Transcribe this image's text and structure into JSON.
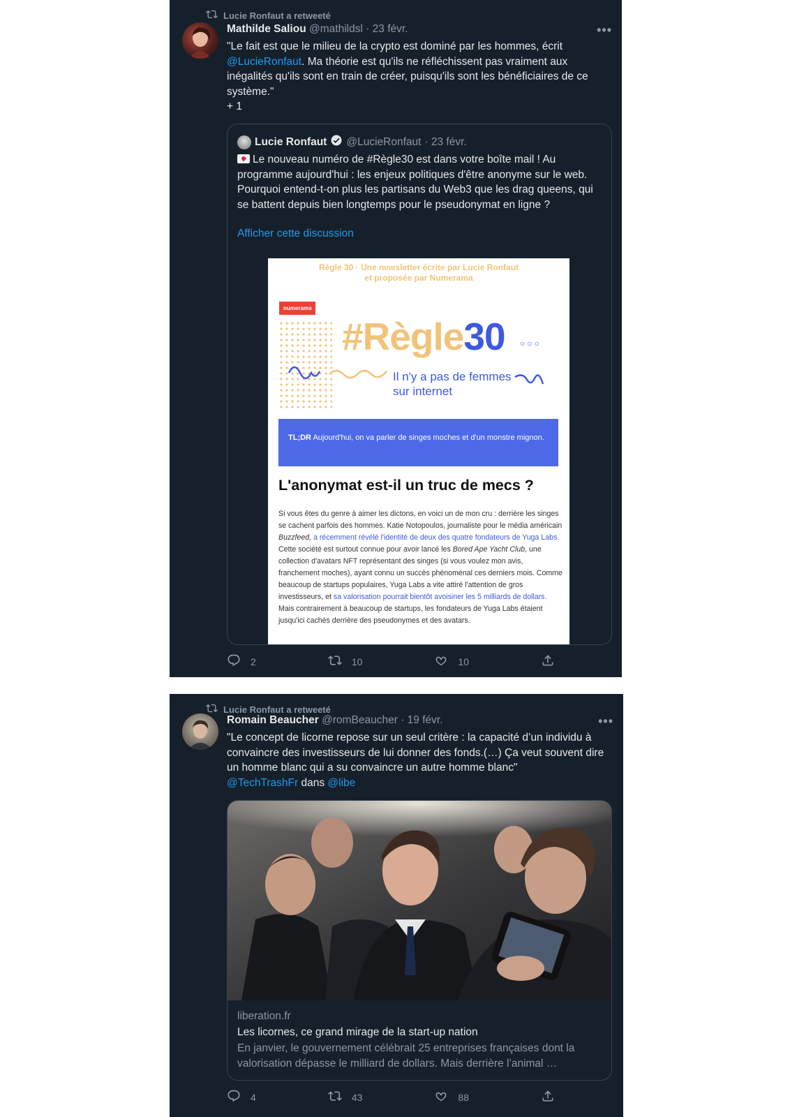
{
  "tweet1": {
    "retweet_label": "Lucie Ronfaut a retweeté",
    "author": "Mathilde Saliou",
    "handle": "@mathildsl",
    "date": "· 23 févr.",
    "more": "•••",
    "text_1": "\"Le fait est que le milieu de la crypto est dominé par les hommes, écrit ",
    "mention": "@LucieRonfaut",
    "text_2": ". Ma théorie est qu'ils ne réfléchissent pas vraiment aux inégalités qu'ils sont en train de créer, puisqu'ils sont les bénéficiaires de ce système.\"",
    "text_3": "+ 1",
    "quote": {
      "author": "Lucie Ronfaut",
      "handle": "@LucieRonfaut",
      "date": "· 23 févr.",
      "text": "Le nouveau numéro de #Règle30 est dans votre boîte mail ! Au programme aujourd'hui : les enjeux politiques d'être anonyme sur le web. Pourquoi entend-t-on plus les partisans du Web3 que les drag queens, qui se battent depuis bien longtemps pour le pseudonymat en ligne ?",
      "show_thread": "Afficher cette discussion"
    },
    "newsletter": {
      "top_line_1": "Règle 30 · Une newsletter écrite par Lucie Ronfaut",
      "top_line_2": "et proposée par Numerama",
      "tag": "numerama",
      "title_hash": "#Règle",
      "title_num": "30",
      "subtitle_1": "Il n'y a pas de femmes",
      "subtitle_2": "sur internet",
      "tldr_label": "TL;DR",
      "tldr_text": "Aujourd'hui, on va parler de singes moches et d'un monstre mignon.",
      "headline": "L'anonymat est-il un truc de mecs ?",
      "p1": "Si vous êtes du genre à aimer les dictons, en voici un de mon cru : derrière les singes se cachent parfois des hommes. Katie Notopoulos, journaliste pour le média américain ",
      "p1_em": "Buzzfeed,",
      "p1_link": " a récemment révélé l'identité de deux des quatre fondateurs de Yuga Labs.",
      "p2": " Cette société est surtout connue pour avoir lancé les ",
      "p2_em": "Bored Ape Yacht Club,",
      "p3": " une collection d'avatars NFT représentant des singes (si vous voulez mon avis, franchement moches), ayant connu un succès phénoménal ces derniers mois. Comme beaucoup de startups populaires, Yuga Labs a vite attiré l'attention de gros investisseurs, et ",
      "p3_link": "sa valorisation pourrait bientôt avoisiner les 5 milliards de dollars.",
      "p4": " Mais contrairement à beaucoup de startups, les fondateurs de Yuga Labs étaient jusqu'ici cachés derrière des pseudonymes et des avatars."
    },
    "replies": "2",
    "retweets": "10",
    "likes": "10"
  },
  "tweet2": {
    "retweet_label": "Lucie Ronfaut a retweeté",
    "author": "Romain Beaucher",
    "handle": "@romBeaucher",
    "date": "· 19 févr.",
    "more": "•••",
    "text_1": "\"Le concept de licorne repose sur un seul critère : la capacité d’un individu à convaincre des investisseurs de lui donner des fonds.(…) Ça veut souvent dire un homme blanc qui a su convaincre un autre homme blanc\"",
    "mention_1": "@TechTrashFr",
    "dans": " dans ",
    "mention_2": "@libe",
    "card": {
      "domain": "liberation.fr",
      "title": "Les licornes, ce grand mirage de la start-up nation",
      "description": "En janvier, le gouvernement célébrait 25 entreprises françaises dont la valorisation dépasse le milliard de dollars. Mais derrière l’animal …"
    },
    "replies": "4",
    "retweets": "43",
    "likes": "88"
  },
  "colors": {
    "background": "#15202b",
    "text": "#e7e9ea",
    "muted": "#8b98a5",
    "link": "#1d9bf0",
    "border": "#38444d"
  },
  "icons": [
    "retweet-icon",
    "reply-icon",
    "like-icon",
    "share-icon",
    "verified-icon",
    "more-icon"
  ]
}
